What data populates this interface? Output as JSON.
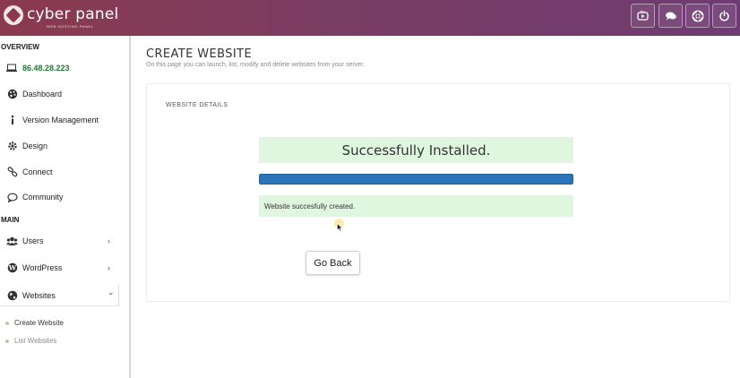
{
  "header": {
    "brand": "cyber panel",
    "brand_tagline": "WEB HOSTING PANEL",
    "collapse_glyph": "‹",
    "buttons": [
      {
        "name": "youtube-button",
        "icon": "youtube-icon"
      },
      {
        "name": "chat-button",
        "icon": "chat-bubbles-icon"
      },
      {
        "name": "support-button",
        "icon": "lifebuoy-icon"
      },
      {
        "name": "power-button",
        "icon": "power-icon"
      }
    ]
  },
  "sidebar": {
    "overview_heading": "OVERVIEW",
    "server_ip": "86.48.28.223",
    "overview_items": [
      {
        "label": "Dashboard",
        "icon": "palette-icon"
      },
      {
        "label": "Version Management",
        "icon": "info-icon"
      },
      {
        "label": "Design",
        "icon": "gear-icon"
      },
      {
        "label": "Connect",
        "icon": "link-icon"
      },
      {
        "label": "Community",
        "icon": "comment-icon"
      }
    ],
    "main_heading": "MAIN",
    "main_items": [
      {
        "label": "Users",
        "icon": "users-icon",
        "chevron": "›"
      },
      {
        "label": "WordPress",
        "icon": "wordpress-icon",
        "chevron": "›"
      },
      {
        "label": "Websites",
        "icon": "globe-icon",
        "chevron": "⌄"
      }
    ],
    "website_subitems": [
      {
        "label": "Create Website"
      },
      {
        "label": "List Websites"
      }
    ]
  },
  "page": {
    "title": "CREATE WEBSITE",
    "subtitle": "On this page you can launch, list, modify and delete websites from your server.",
    "card_title": "WEBSITE DETAILS",
    "success_message": "Successfully Installed.",
    "progress_percent": 100,
    "info_message": "Website succesfully created.",
    "go_back_label": "Go Back"
  },
  "colors": {
    "header_gradient_start": "#8b3a4e",
    "header_gradient_end": "#6e3c73",
    "success_bg": "#e0f7df",
    "progress_fill": "#2a74b8",
    "ip_green": "#1e7a2f"
  }
}
